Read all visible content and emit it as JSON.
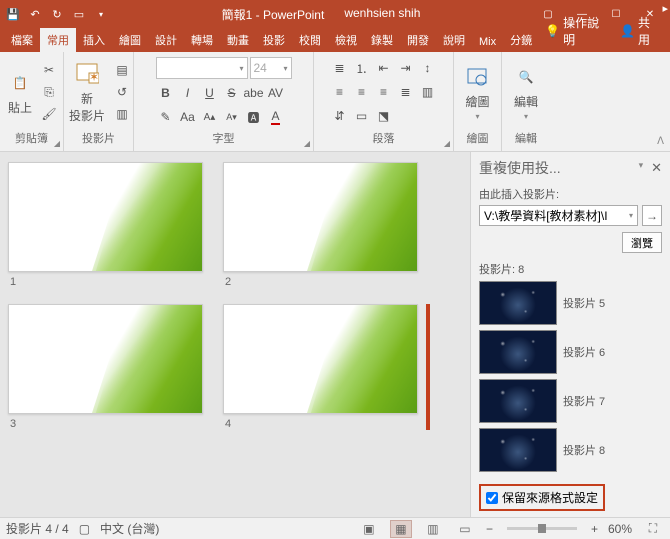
{
  "titlebar": {
    "doc": "簡報1 - PowerPoint",
    "user": "wenhsien shih"
  },
  "tabs": {
    "file": "檔案",
    "home": "常用",
    "insert": "插入",
    "draw": "繪圖",
    "design": "設計",
    "transitions": "轉場",
    "animations": "動畫",
    "slideshow": "投影",
    "review": "校閱",
    "view": "檢視",
    "recording": "錄製",
    "developer": "開發",
    "help": "說明",
    "mix": "Mix",
    "storyboarding": "分鏡",
    "tell": "操作說明",
    "share": "共用"
  },
  "ribbon": {
    "clipboard": {
      "paste": "貼上",
      "label": "剪貼簿"
    },
    "slides": {
      "new": "新\n投影片",
      "label": "投影片"
    },
    "font": {
      "size": "24",
      "label": "字型"
    },
    "paragraph": {
      "label": "段落"
    },
    "drawing": {
      "btn": "繪圖",
      "label": "繪圖"
    },
    "editing": {
      "btn": "編輯",
      "label": "編輯"
    }
  },
  "slides": [
    {
      "num": "1"
    },
    {
      "num": "2"
    },
    {
      "num": "3"
    },
    {
      "num": "4"
    }
  ],
  "pane": {
    "title": "重複使用投...",
    "insertFrom": "由此插入投影片:",
    "path": "V:\\教學資料[教材素材]\\I",
    "browse": "瀏覽",
    "count": "投影片: 8",
    "items": [
      {
        "label": "投影片 5"
      },
      {
        "label": "投影片 6"
      },
      {
        "label": "投影片 7"
      },
      {
        "label": "投影片 8"
      }
    ],
    "keep": "保留來源格式設定"
  },
  "status": {
    "pos": "投影片 4 / 4",
    "lang": "中文 (台灣)",
    "zoom": "60%"
  }
}
